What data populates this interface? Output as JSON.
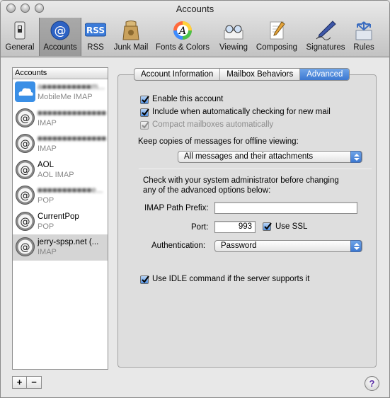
{
  "window": {
    "title": "Accounts"
  },
  "toolbar": {
    "items": [
      {
        "label": "General",
        "icon": "general-switch-icon"
      },
      {
        "label": "Accounts",
        "icon": "at-sign-icon"
      },
      {
        "label": "RSS",
        "icon": "rss-icon"
      },
      {
        "label": "Junk Mail",
        "icon": "junk-bag-icon"
      },
      {
        "label": "Fonts & Colors",
        "icon": "fonts-colors-icon"
      },
      {
        "label": "Viewing",
        "icon": "glasses-icon"
      },
      {
        "label": "Composing",
        "icon": "pencil-paper-icon"
      },
      {
        "label": "Signatures",
        "icon": "pen-signature-icon"
      },
      {
        "label": "Rules",
        "icon": "rules-arrows-icon"
      }
    ]
  },
  "accounts": {
    "header": "Accounts",
    "items": [
      {
        "name": "",
        "type": "MobileMe IMAP",
        "icon": "mobileme-cloud-icon"
      },
      {
        "name": "",
        "type": "IMAP",
        "icon": "at-sign-icon"
      },
      {
        "name": "",
        "type": "IMAP",
        "icon": "at-sign-icon"
      },
      {
        "name": "AOL",
        "type": "AOL IMAP",
        "icon": "aol-icon"
      },
      {
        "name": "",
        "type": "POP",
        "icon": "at-sign-icon"
      },
      {
        "name": "CurrentPop",
        "type": "POP",
        "icon": "at-sign-icon"
      },
      {
        "name": "jerry-spsp.net (...",
        "type": "IMAP",
        "icon": "at-sign-icon"
      }
    ],
    "add_label": "+",
    "remove_label": "−"
  },
  "tabs": [
    "Account Information",
    "Mailbox Behaviors",
    "Advanced"
  ],
  "advanced": {
    "enable_account": "Enable this account",
    "include_checking": "Include when automatically checking for new mail",
    "compact_mailboxes": "Compact mailboxes automatically",
    "keep_copies_label": "Keep copies of messages for offline viewing:",
    "keep_copies_value": "All messages and their attachments",
    "admin_note_1": "Check with your system administrator before changing",
    "admin_note_2": "any of the advanced options below:",
    "imap_prefix_label": "IMAP Path Prefix:",
    "imap_prefix_value": "",
    "port_label": "Port:",
    "port_value": "993",
    "use_ssl": "Use SSL",
    "auth_label": "Authentication:",
    "auth_value": "Password",
    "use_idle": "Use IDLE command if the server supports it"
  },
  "help": "?",
  "colors": {
    "accent": "#3c78d1",
    "selected_row": "#d5d5d5"
  }
}
